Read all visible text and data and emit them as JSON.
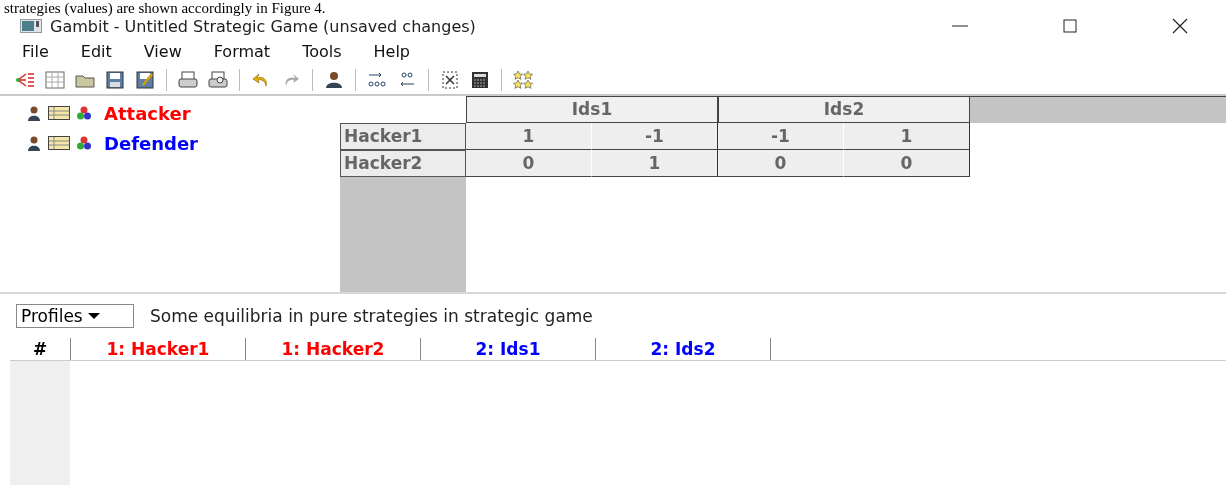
{
  "document_text": "strategies (values) are shown accordingly in Figure 4.",
  "window": {
    "title": "Gambit - Untitled Strategic Game (unsaved changes)"
  },
  "menu": [
    "File",
    "Edit",
    "View",
    "Format",
    "Tools",
    "Help"
  ],
  "players": [
    {
      "name": "Attacker",
      "color": "#ff0000"
    },
    {
      "name": "Defender",
      "color": "#0000ff"
    }
  ],
  "payoff_table": {
    "column_strategies": [
      "Ids1",
      "Ids2"
    ],
    "rows": [
      {
        "strategy": "Hacker1",
        "payoffs": [
          "1",
          "-1",
          "-1",
          "1"
        ]
      },
      {
        "strategy": "Hacker2",
        "payoffs": [
          "0",
          "1",
          "0",
          "0"
        ]
      }
    ]
  },
  "profiles": {
    "dropdown": "Profiles",
    "description": "Some equilibria in pure strategies in strategic game",
    "columns": [
      {
        "label": "#",
        "color": "#000000"
      },
      {
        "label": "1: Hacker1",
        "color": "#ff0000"
      },
      {
        "label": "1: Hacker2",
        "color": "#ff0000"
      },
      {
        "label": "2: Ids1",
        "color": "#0000ff"
      },
      {
        "label": "2: Ids2",
        "color": "#0000ff"
      }
    ]
  }
}
